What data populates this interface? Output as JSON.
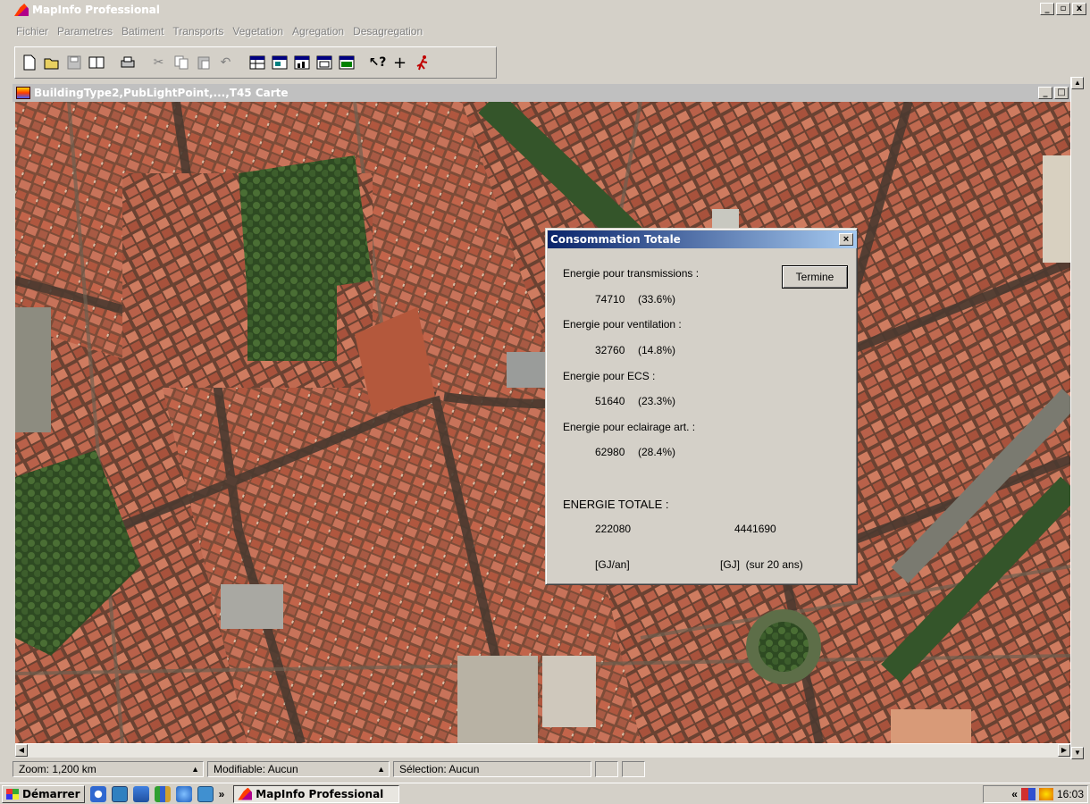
{
  "app": {
    "title": "MapInfo Professional"
  },
  "menu": [
    "Fichier",
    "Parametres",
    "Batiment",
    "Transports",
    "Vegetation",
    "Agregation",
    "Desagregation"
  ],
  "toolbar": {
    "icons": [
      "new-icon",
      "open-icon",
      "save-icon",
      "close-window-icon",
      "print-icon",
      "cut-icon",
      "copy-icon",
      "paste-icon",
      "undo-icon",
      "new-browser-icon",
      "new-mapper-icon",
      "new-grapher-icon",
      "new-layout-icon",
      "redistrict-icon",
      "help-pointer-icon",
      "crosshair-icon",
      "run-icon"
    ],
    "help_glyph": "?"
  },
  "map_window": {
    "title": "BuildingType2,PubLightPoint,...,T45 Carte"
  },
  "dialog": {
    "title": "Consommation Totale",
    "close_glyph": "×",
    "button": "Termine",
    "rows": [
      {
        "label": "Energie pour transmissions :",
        "value": "74710",
        "pct": "(33.6%)"
      },
      {
        "label": "Energie pour ventilation :",
        "value": "32760",
        "pct": "(14.8%)"
      },
      {
        "label": "Energie pour ECS :",
        "value": "51640",
        "pct": "(23.3%)"
      },
      {
        "label": "Energie pour eclairage art. :",
        "value": "62980",
        "pct": "(28.4%)"
      }
    ],
    "total_label": "ENERGIE TOTALE :",
    "total_annual": "222080",
    "total_20y": "4441690",
    "unit_annual": "[GJ/an]",
    "unit_20y": "[GJ]  (sur 20 ans)"
  },
  "status": {
    "zoom": "Zoom: 1,200 km",
    "modifiable": "Modifiable: Aucun",
    "selection": "Sélection: Aucun"
  },
  "taskbar": {
    "start": "Démarrer",
    "chevron": "»",
    "task": "MapInfo Professional",
    "tray_chevron": "«",
    "clock": "16:03"
  },
  "colors": {
    "dialog_title_start": "#0a246a",
    "dialog_title_end": "#a6caf0",
    "chrome": "#d4d0c8"
  }
}
